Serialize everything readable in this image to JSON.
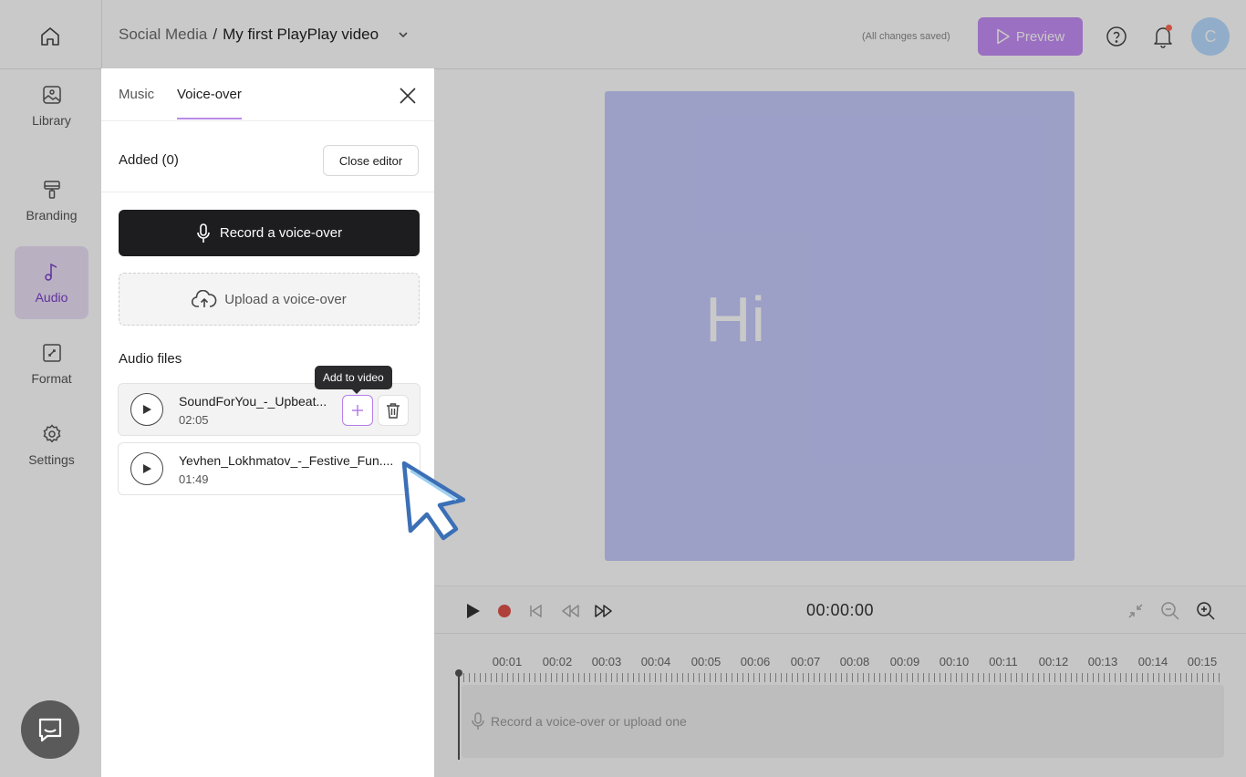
{
  "header": {
    "breadcrumb_folder": "Social Media",
    "breadcrumb_sep": "/",
    "project_title": "My first PlayPlay video",
    "save_status": "(All changes saved)",
    "preview_label": "Preview",
    "avatar_initial": "C",
    "accent_color": "#c58df5"
  },
  "sidebar": {
    "items": [
      {
        "label": "Library",
        "icon": "image-icon"
      },
      {
        "label": "Branding",
        "icon": "paint-roller-icon"
      },
      {
        "label": "Audio",
        "icon": "music-note-icon",
        "active": true
      },
      {
        "label": "Format",
        "icon": "resize-icon"
      },
      {
        "label": "Settings",
        "icon": "gear-icon"
      }
    ]
  },
  "panel": {
    "tabs": [
      {
        "label": "Music"
      },
      {
        "label": "Voice-over",
        "active": true
      }
    ],
    "added_label": "Added (0)",
    "close_editor_label": "Close editor",
    "record_label": "Record a voice-over",
    "upload_label": "Upload a voice-over",
    "audio_files_label": "Audio files",
    "files": [
      {
        "name": "SoundForYou_-_Upbeat...",
        "duration": "02:05"
      },
      {
        "name": "Yevhen_Lokhmatov_-_Festive_Fun....",
        "duration": "01:49"
      }
    ],
    "tooltip": "Add to video"
  },
  "canvas": {
    "video_text": "Hi",
    "frame_color": "#c6cafc"
  },
  "timeline": {
    "current_time": "00:00:00",
    "ruler_labels": [
      "00:01",
      "00:02",
      "00:03",
      "00:04",
      "00:05",
      "00:06",
      "00:07",
      "00:08",
      "00:09",
      "00:10",
      "00:11",
      "00:12",
      "00:13",
      "00:14",
      "00:15"
    ],
    "track_placeholder": "Record a voice-over or upload one"
  }
}
